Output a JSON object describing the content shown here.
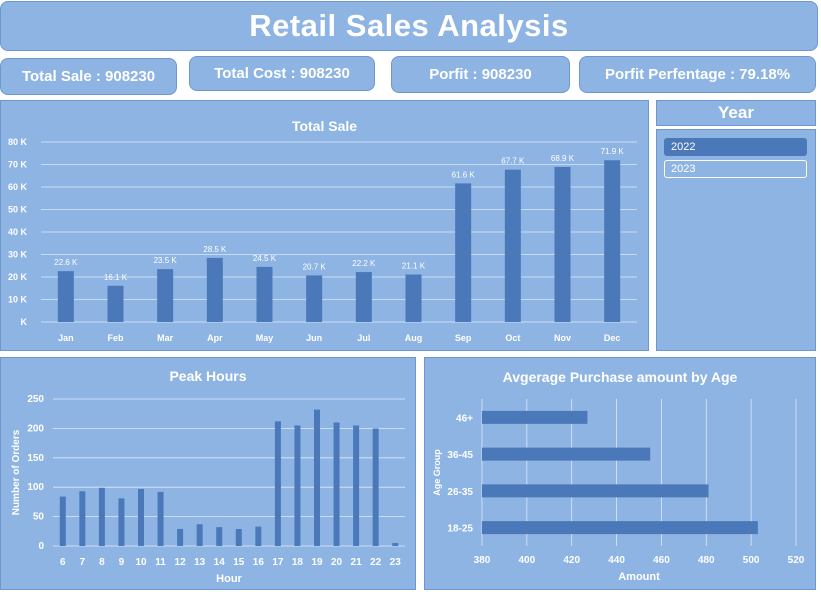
{
  "dashboard": {
    "title": "Retail Sales Analysis"
  },
  "kpis": [
    {
      "label": "Total Sale : 908230"
    },
    {
      "label": "Total Cost : 908230"
    },
    {
      "label": "Porfit : 908230"
    },
    {
      "label": "Porfit Perfentage : 79.18%"
    }
  ],
  "year_slicer": {
    "header": "Year",
    "options": [
      "2022",
      "2023"
    ],
    "selected": "2022"
  },
  "colors": {
    "panel": "#8eb4e3",
    "bar": "#4a78b9",
    "text": "#ffffff"
  },
  "chart_data": [
    {
      "id": "total_sale",
      "type": "bar",
      "title": "Total Sale",
      "categories": [
        "Jan",
        "Feb",
        "Mar",
        "Apr",
        "May",
        "Jun",
        "Jul",
        "Aug",
        "Sep",
        "Oct",
        "Nov",
        "Dec"
      ],
      "values": [
        22.6,
        16.1,
        23.5,
        28.5,
        24.5,
        20.7,
        22.2,
        21.1,
        61.6,
        67.7,
        68.9,
        71.9
      ],
      "data_labels": [
        "22.6 K",
        "16.1 K",
        "23.5 K",
        "28.5 K",
        "24.5 K",
        "20.7 K",
        "22.2 K",
        "21.1 K",
        "61.6 K",
        "67.7 K",
        "68.9 K",
        "71.9 K"
      ],
      "yticks": [
        "K",
        "10 K",
        "20 K",
        "30 K",
        "40 K",
        "50 K",
        "60 K",
        "70 K",
        "80 K"
      ],
      "ylim": [
        0,
        80
      ],
      "grid": true
    },
    {
      "id": "peak_hours",
      "type": "bar",
      "title": "Peak Hours",
      "xlabel": "Hour",
      "ylabel": "Number of Orders",
      "categories": [
        "6",
        "7",
        "8",
        "9",
        "10",
        "11",
        "12",
        "13",
        "14",
        "15",
        "16",
        "17",
        "18",
        "19",
        "20",
        "21",
        "22",
        "23"
      ],
      "values": [
        84,
        93,
        99,
        81,
        97,
        92,
        29,
        37,
        32,
        29,
        33,
        212,
        205,
        232,
        210,
        205,
        200,
        5
      ],
      "yticks": [
        "0",
        "50",
        "100",
        "150",
        "200",
        "250"
      ],
      "ylim": [
        0,
        250
      ],
      "grid": true
    },
    {
      "id": "avg_purchase_by_age",
      "type": "bar",
      "orientation": "horizontal",
      "title": "Avgerage Purchase amount by Age",
      "xlabel": "Amount",
      "ylabel": "Age Group",
      "categories": [
        "46+",
        "36-45",
        "26-35",
        "18-25"
      ],
      "values": [
        427,
        455,
        481,
        503
      ],
      "xticks": [
        "380",
        "400",
        "420",
        "440",
        "460",
        "480",
        "500",
        "520"
      ],
      "xlim": [
        380,
        520
      ],
      "grid": true
    }
  ]
}
